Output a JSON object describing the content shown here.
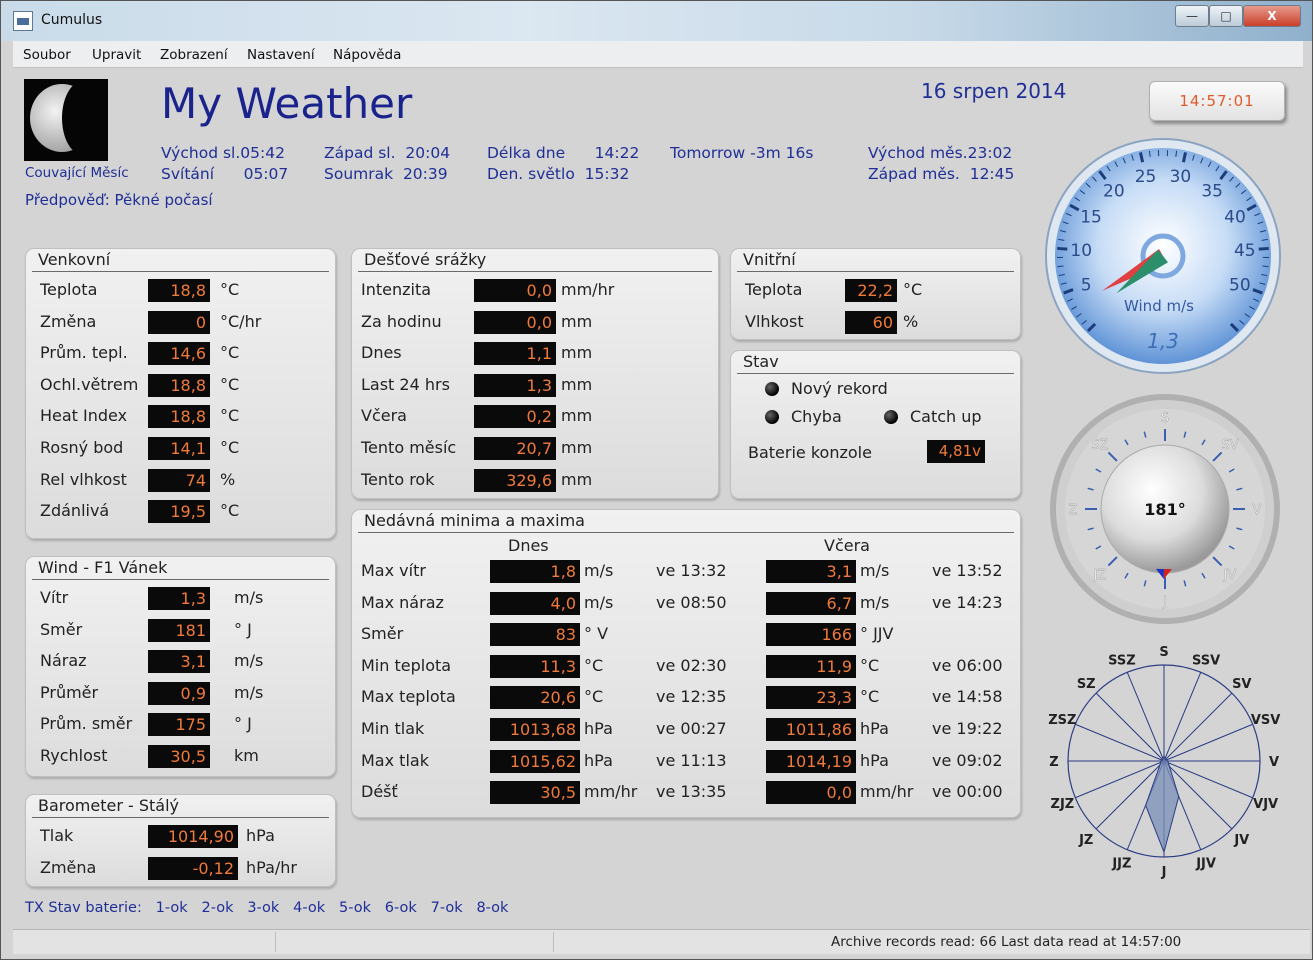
{
  "window": {
    "title": "Cumulus",
    "min": "—",
    "max": "□",
    "close": "X"
  },
  "menu": [
    "Soubor",
    "Upravit",
    "Zobrazení",
    "Nastavení",
    "Nápověda"
  ],
  "moon": {
    "label": "Couvající Měsíc"
  },
  "forecast": "Předpověď: Pěkné počasí",
  "station": "My Weather",
  "date": "16 srpen 2014",
  "clock": "14:57:01",
  "sun": {
    "c1a": "Východ sl.05:42",
    "c1b": "Svítání      05:07",
    "c2a": "Západ sl.  20:04",
    "c2b": "Soumrak  20:39",
    "c3a": "Délka dne      14:22",
    "c3b": "Den. světlo  15:32",
    "c4a": "Tomorrow -3m 16s",
    "c5a": "Východ měs.23:02",
    "c5b": "Západ měs.  12:45"
  },
  "outdoor": {
    "title": "Venkovní",
    "rows": [
      {
        "label": "Teplota",
        "value": "18,8",
        "unit": "°C"
      },
      {
        "label": "Změna",
        "value": "0",
        "unit": "°C/hr"
      },
      {
        "label": "Prům. tepl.",
        "value": "14,6",
        "unit": "°C"
      },
      {
        "label": "Ochl.větrem",
        "value": "18,8",
        "unit": "°C"
      },
      {
        "label": "Heat Index",
        "value": "18,8",
        "unit": "°C"
      },
      {
        "label": "Rosný bod",
        "value": "14,1",
        "unit": "°C"
      },
      {
        "label": "Rel vlhkost",
        "value": "74",
        "unit": "%"
      },
      {
        "label": "Zdánlivá",
        "value": "19,5",
        "unit": "°C"
      }
    ]
  },
  "wind": {
    "title": "Wind - F1 Vánek",
    "rows": [
      {
        "label": "Vítr",
        "value": "1,3",
        "unit": "m/s"
      },
      {
        "label": "Směr",
        "value": "181",
        "unit": "° J"
      },
      {
        "label": "Náraz",
        "value": "3,1",
        "unit": "m/s"
      },
      {
        "label": "Průměr",
        "value": "0,9",
        "unit": "m/s"
      },
      {
        "label": "Prům. směr",
        "value": "175",
        "unit": "° J"
      },
      {
        "label": "Rychlost",
        "value": "30,5",
        "unit": "km"
      }
    ]
  },
  "baro": {
    "title": "Barometer - Stálý",
    "rows": [
      {
        "label": "Tlak",
        "value": "1014,90",
        "unit": "hPa"
      },
      {
        "label": "Změna",
        "value": "-0,12",
        "unit": "hPa/hr"
      }
    ]
  },
  "rain": {
    "title": "Dešťové srážky",
    "rows": [
      {
        "label": "Intenzita",
        "value": "0,0",
        "unit": "mm/hr"
      },
      {
        "label": "Za hodinu",
        "value": "0,0",
        "unit": "mm"
      },
      {
        "label": "Dnes",
        "value": "1,1",
        "unit": "mm"
      },
      {
        "label": "Last 24 hrs",
        "value": "1,3",
        "unit": "mm"
      },
      {
        "label": "Včera",
        "value": "0,2",
        "unit": "mm"
      },
      {
        "label": "Tento měsíc",
        "value": "20,7",
        "unit": "mm"
      },
      {
        "label": "Tento rok",
        "value": "329,6",
        "unit": "mm"
      }
    ]
  },
  "indoor": {
    "title": "Vnitřní",
    "rows": [
      {
        "label": "Teplota",
        "value": "22,2",
        "unit": "°C"
      },
      {
        "label": "Vlhkost",
        "value": "60",
        "unit": "%"
      }
    ]
  },
  "status": {
    "title": "Stav",
    "new_record": "Nový rekord",
    "error": "Chyba",
    "catchup": "Catch up",
    "battery_label": "Baterie konzole",
    "battery_value": "4,81v"
  },
  "minmax": {
    "title": "Nedávná minima a maxima",
    "today": "Dnes",
    "yesterday": "Včera",
    "rows": [
      {
        "label": "Max vítr",
        "t_val": "1,8",
        "t_unit": "m/s",
        "t_time": "ve 13:32",
        "y_val": "3,1",
        "y_unit": "m/s",
        "y_time": "ve 13:52"
      },
      {
        "label": "Max náraz",
        "t_val": "4,0",
        "t_unit": "m/s",
        "t_time": "ve 08:50",
        "y_val": "6,7",
        "y_unit": "m/s",
        "y_time": "ve 14:23"
      },
      {
        "label": "Směr",
        "t_val": "83",
        "t_unit": "°  V",
        "t_time": "",
        "y_val": "166",
        "y_unit": "°  JJV",
        "y_time": ""
      },
      {
        "label": "Min teplota",
        "t_val": "11,3",
        "t_unit": "°C",
        "t_time": "ve 02:30",
        "y_val": "11,9",
        "y_unit": "°C",
        "y_time": "ve 06:00"
      },
      {
        "label": "Max teplota",
        "t_val": "20,6",
        "t_unit": "°C",
        "t_time": "ve 12:35",
        "y_val": "23,3",
        "y_unit": "°C",
        "y_time": "ve 14:58"
      },
      {
        "label": "Min tlak",
        "t_val": "1013,68",
        "t_unit": "hPa",
        "t_time": "ve 00:27",
        "y_val": "1011,86",
        "y_unit": "hPa",
        "y_time": "ve 19:22"
      },
      {
        "label": "Max tlak",
        "t_val": "1015,62",
        "t_unit": "hPa",
        "t_time": "ve 11:13",
        "y_val": "1014,19",
        "y_unit": "hPa",
        "y_time": "ve 09:02"
      },
      {
        "label": "Déšť",
        "t_val": "30,5",
        "t_unit": "mm/hr",
        "t_time": "ve 13:35",
        "y_val": "0,0",
        "y_unit": "mm/hr",
        "y_time": "ve 00:00"
      }
    ]
  },
  "gauge": {
    "label": "Wind m/s",
    "value": "1,3",
    "ticks": [
      "5",
      "10",
      "15",
      "20",
      "25",
      "30",
      "35",
      "40",
      "45",
      "50"
    ],
    "needle": 1.3,
    "needle2": 3.1
  },
  "compass": {
    "value": "181°",
    "labels": [
      "S",
      "SV",
      "V",
      "JV",
      "J",
      "JZ",
      "Z",
      "SZ"
    ],
    "direction": 181
  },
  "rose": {
    "labels": [
      "S",
      "SSV",
      "SV",
      "VSV",
      "V",
      "VJV",
      "JV",
      "JJV",
      "J",
      "JJZ",
      "JZ",
      "ZJZ",
      "Z",
      "ZSZ",
      "SZ",
      "SSZ"
    ],
    "petals": [
      0.05,
      0.03,
      0.02,
      0.03,
      0.04,
      0.05,
      0.08,
      0.4,
      0.95,
      0.5,
      0.06,
      0.04,
      0.03,
      0.02,
      0.02,
      0.03
    ]
  },
  "tx": "TX Stav baterie:   1-ok   2-ok   3-ok   4-ok   5-ok   6-ok   7-ok   8-ok",
  "statusbar": "Archive records read: 66  Last data read at 14:57:00"
}
